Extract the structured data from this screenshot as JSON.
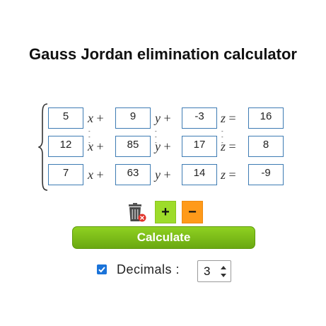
{
  "title": "Gauss Jordan elimination calculator",
  "equations": [
    {
      "a": "5",
      "b": "9",
      "c": "-3",
      "d": "16"
    },
    {
      "a": "12",
      "b": "85",
      "c": "17",
      "d": "8"
    },
    {
      "a": "7",
      "b": "63",
      "c": "14",
      "d": "-9"
    }
  ],
  "variables": {
    "x": "x",
    "y": "y",
    "z": "z",
    "plus": "+",
    "equals": "="
  },
  "tools": {
    "plus_label": "+",
    "minus_label": "−"
  },
  "calculate_label": "Calculate",
  "decimals": {
    "label": "Decimals :",
    "value": "3",
    "checked": true
  },
  "colors": {
    "input_border": "#3d7bb3",
    "plus_button": "#9ddc2a",
    "minus_button": "#ff9a1a",
    "calculate_button": "#7cbd16",
    "checkbox": "#1a73d9"
  },
  "icons": {
    "trash": "trash-icon",
    "checkbox": "checkmark-icon",
    "spinner": "spinner-arrows-icon"
  }
}
